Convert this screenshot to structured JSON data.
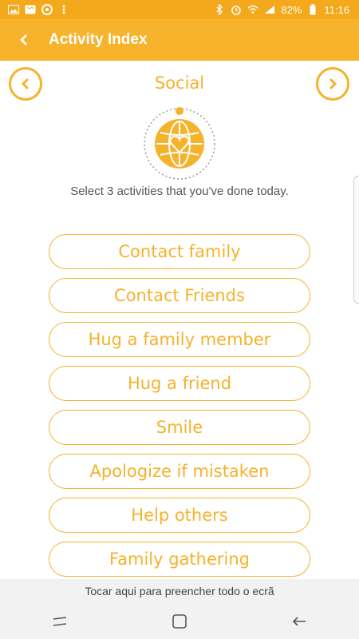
{
  "status_bar": {
    "battery": "82%",
    "time": "11:16",
    "left_icons": [
      "image-icon",
      "map-icon",
      "chrome-icon",
      "more-dots-icon"
    ],
    "right_icons": [
      "bluetooth-icon",
      "alarm-icon",
      "wifi-icon",
      "signal-icon",
      "battery-icon"
    ]
  },
  "app_bar": {
    "title": "Activity Index",
    "back_icon": "chevron-left-icon"
  },
  "category": {
    "title": "Social",
    "prev_icon": "chevron-left-circle-icon",
    "next_icon": "chevron-right-circle-icon",
    "badge_icon": "globe-heart-icon"
  },
  "instructions": "Select 3 activities that you've done today.",
  "activities": [
    "Contact family",
    "Contact Friends",
    "Hug a family member",
    "Hug a friend",
    "Smile",
    "Apologize if mistaken",
    "Help others",
    "Family gathering"
  ],
  "fullscreen_hint": "Tocar aqui para preencher todo o ecrã",
  "system_nav": [
    "recents-icon",
    "home-icon",
    "back-icon"
  ],
  "colors": {
    "accent": "#f5b22b",
    "app_bar": "#f7b32b",
    "status_bar": "#f3a91b",
    "text_secondary": "#555555"
  }
}
